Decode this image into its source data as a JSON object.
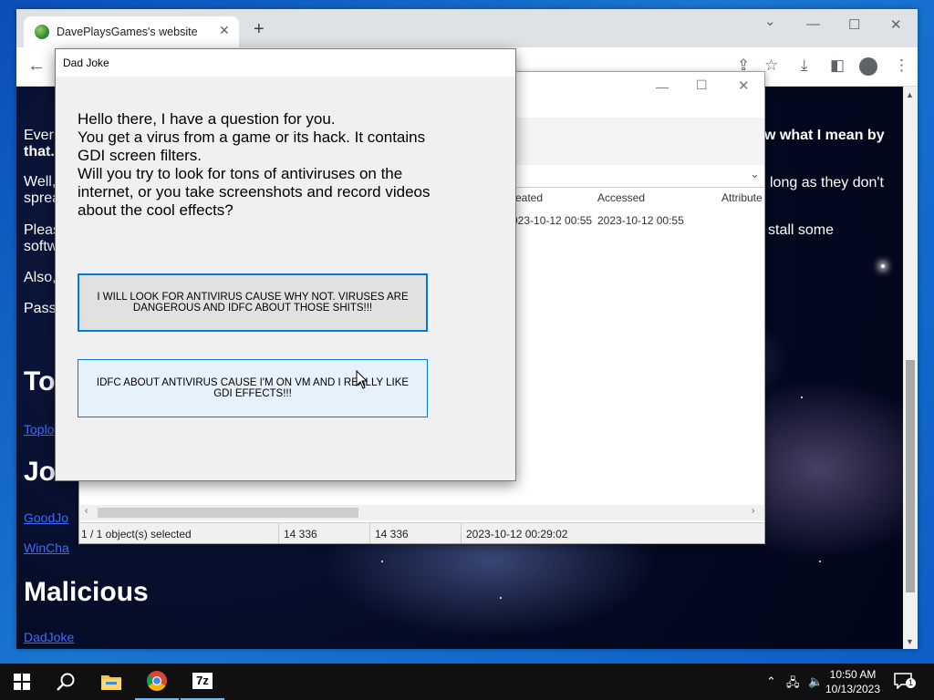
{
  "browser": {
    "tab_title": "DavePlaysGames's website",
    "tab_close": "✕",
    "new_tab": "+",
    "controls": {
      "chevron": "⌄",
      "minimize": "—",
      "maximize": "☐",
      "close": "✕"
    },
    "toolbar": {
      "back": "←",
      "share": "⇪",
      "star": "☆",
      "download": "⤓",
      "sidebar": "◧",
      "menu": "⋮"
    }
  },
  "webpage": {
    "fragments": [
      "Ever",
      "that.",
      "Well,",
      "sprea",
      "Pleas",
      "softw",
      "Also,",
      "Pass"
    ],
    "right_fragments": [
      "w what I mean by",
      "long as they don't",
      "stall some"
    ],
    "heading_to": "To",
    "link_toplo": "Toplo",
    "heading_jo": "Jo",
    "link_goodjo": "GoodJo",
    "link_wincha": "WinCha",
    "heading_malicious": "Malicious",
    "link_dadjoke": "DadJoke"
  },
  "file_manager": {
    "controls": {
      "minimize": "—",
      "maximize": "☐",
      "close": "✕"
    },
    "columns": {
      "created": "reated",
      "accessed": "Accessed",
      "attributes": "Attribute"
    },
    "row": {
      "created": "023-10-12 00:55",
      "accessed": "2023-10-12 00:55"
    },
    "status": {
      "selected": "1 / 1 object(s) selected",
      "size1": "14 336",
      "size2": "14 336",
      "date": "2023-10-12 00:29:02"
    }
  },
  "dialog": {
    "title": "Dad Joke",
    "message": [
      "Hello there, I have a question for you.",
      "You get a virus from a game or its hack. It contains",
      "GDI screen filters.",
      "Will you try to look for tons of antiviruses on the",
      "internet, or you take screenshots and record videos",
      "about the cool effects?"
    ],
    "button1": "I WILL LOOK FOR ANTIVIRUS CAUSE WHY NOT. VIRUSES ARE DANGEROUS AND IDFC ABOUT THOSE SHITS!!!",
    "button2": "IDFC ABOUT ANTIVIRUS CAUSE I'M ON VM AND I REALLY LIKE GDI EFFECTS!!!"
  },
  "taskbar": {
    "app_7z": "7z",
    "clock_time": "10:50 AM",
    "clock_date": "10/13/2023",
    "notification_count": "1"
  },
  "colors": {
    "accent": "#0078d7",
    "button2_bg": "#e5f1fb",
    "link": "#3b6cff"
  }
}
